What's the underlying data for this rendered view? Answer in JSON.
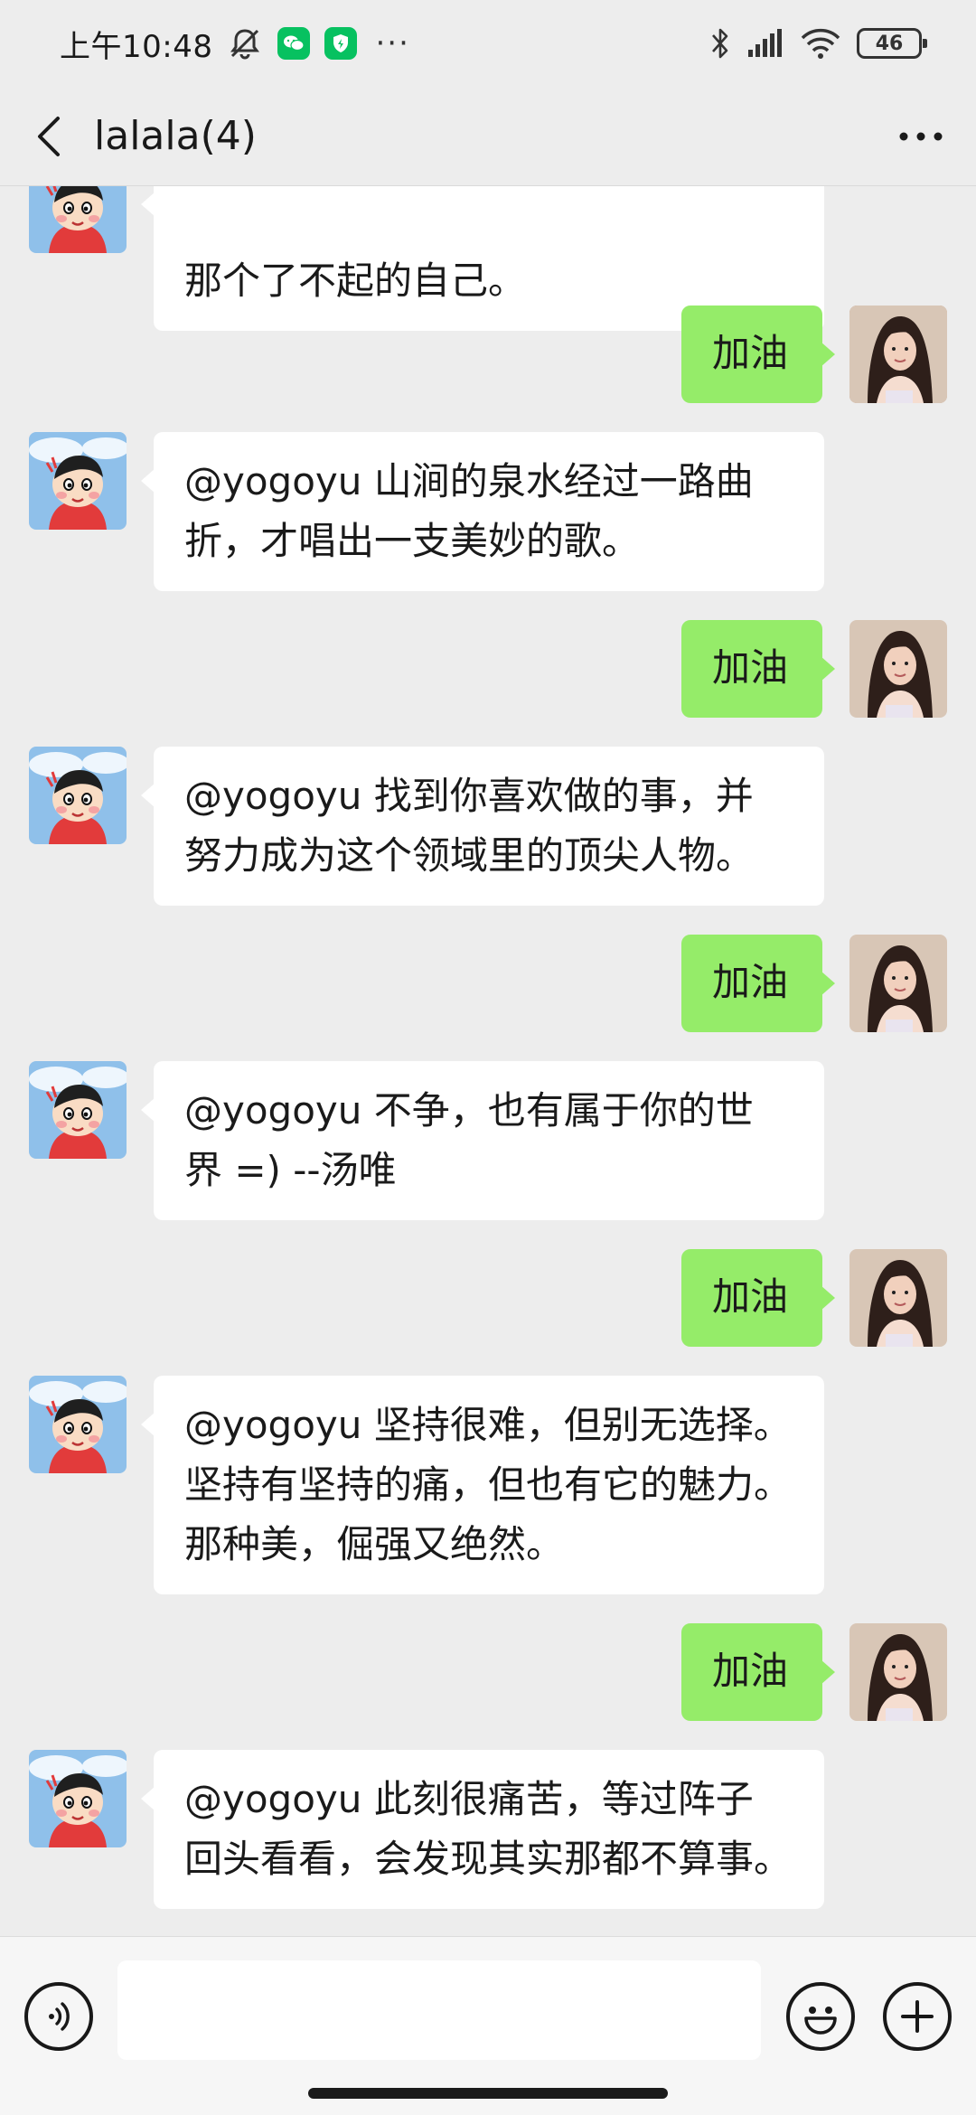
{
  "status_bar": {
    "time": "上午10:48",
    "icons": [
      "mute-icon",
      "wechat-icon",
      "shield-icon",
      "more-dots",
      "bluetooth-icon",
      "signal-icon",
      "wifi-icon",
      "battery-icon"
    ],
    "more": "···",
    "battery": "46"
  },
  "header": {
    "title": "lalala(4)",
    "back_icon": "chevron-left-icon",
    "more_icon": "more-icon"
  },
  "messages": [
    {
      "side": "in",
      "text": "那个了不起的自己。"
    },
    {
      "side": "out",
      "text": "加油"
    },
    {
      "side": "in",
      "lines": [
        "@yogoyu 山涧的泉水经过一路曲",
        "折，才唱出一支美妙的歌。"
      ]
    },
    {
      "side": "out",
      "text": "加油"
    },
    {
      "side": "in",
      "lines": [
        "@yogoyu 找到你喜欢做的事，并",
        "努力成为这个领域里的顶尖人物。"
      ]
    },
    {
      "side": "out",
      "text": "加油"
    },
    {
      "side": "in",
      "lines": [
        "@yogoyu 不争，也有属于你的世",
        "界 =) --汤唯"
      ]
    },
    {
      "side": "out",
      "text": "加油"
    },
    {
      "side": "in",
      "lines": [
        "@yogoyu 坚持很难，但别无选择。",
        "坚持有坚持的痛，但也有它的魅力。",
        "那种美，倔强又绝然。"
      ]
    },
    {
      "side": "out",
      "text": "加油"
    },
    {
      "side": "in",
      "lines": [
        "@yogoyu 此刻很痛苦，等过阵子",
        "回头看看，会发现其实那都不算事。"
      ]
    }
  ],
  "input_bar": {
    "placeholder": "",
    "voice_icon": "voice-icon",
    "emoji_icon": "emoji-icon",
    "plus_icon": "plus-icon"
  },
  "colors": {
    "background": "#ededed",
    "incoming_bubble": "#ffffff",
    "outgoing_bubble": "#95ec69",
    "text": "#1a1a1a"
  }
}
